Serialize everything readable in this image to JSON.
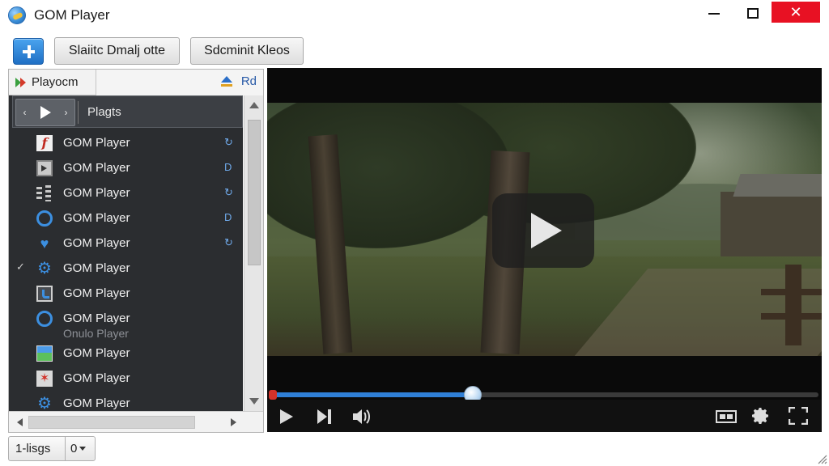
{
  "window": {
    "title": "GOM Player",
    "close_glyph": "✕"
  },
  "toolbar": {
    "button1_label": "Slaiitc Dmalj otte",
    "button2_label": "Sdcminit Kleos"
  },
  "playlist": {
    "tab_label": "Playocm",
    "tool_label": "Rd",
    "header_label": "Plagts",
    "ctrl_prev": "‹",
    "ctrl_next": "›",
    "items": [
      {
        "name": "GOM Player",
        "icon": "flash-icon",
        "status": "↻",
        "check": "",
        "sub": ""
      },
      {
        "name": "GOM Player",
        "icon": "video-icon",
        "status": "D",
        "check": "",
        "sub": ""
      },
      {
        "name": "GOM Player",
        "icon": "equalizer-icon",
        "status": "↻",
        "check": "",
        "sub": ""
      },
      {
        "name": "GOM Player",
        "icon": "ring-icon",
        "status": "D",
        "check": "",
        "sub": ""
      },
      {
        "name": "GOM Player",
        "icon": "heart-icon",
        "status": "↻",
        "check": "",
        "sub": ""
      },
      {
        "name": "GOM Player",
        "icon": "gear-icon",
        "status": "",
        "check": "✓",
        "sub": ""
      },
      {
        "name": "GOM Player",
        "icon": "monitor-icon",
        "status": "",
        "check": "",
        "sub": ""
      },
      {
        "name": "GOM Player",
        "icon": "ring-icon",
        "status": "",
        "check": "",
        "sub": "Onulo Player"
      },
      {
        "name": "GOM Player",
        "icon": "image-icon",
        "status": "",
        "check": "",
        "sub": ""
      },
      {
        "name": "GOM Player",
        "icon": "star-icon",
        "status": "",
        "check": "",
        "sub": ""
      },
      {
        "name": "GOM Player",
        "icon": "gear-icon",
        "status": "",
        "check": "",
        "sub": ""
      }
    ]
  },
  "bottom": {
    "left_label": "1-lisgs",
    "right_label": "0"
  },
  "player": {
    "progress_fraction": 0.37,
    "time_text": "",
    "accent_color": "#2f7fd6",
    "close_color": "#e81123"
  }
}
